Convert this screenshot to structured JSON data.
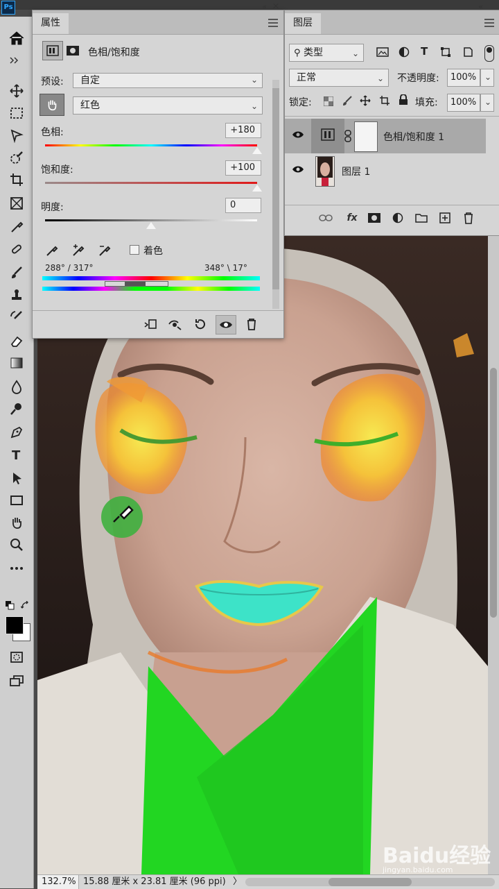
{
  "app": {
    "logo": "Ps"
  },
  "properties_panel": {
    "tab": "属性",
    "title": "色相/饱和度",
    "preset_label": "预设:",
    "preset_value": "自定",
    "channel_value": "红色",
    "hue_label": "色相:",
    "hue_value": "+180",
    "hue_level": 1.0,
    "saturation_label": "饱和度:",
    "saturation_value": "+100",
    "saturation_level": 1.0,
    "lightness_label": "明度:",
    "lightness_value": "0",
    "lightness_level": 0.5,
    "colorize_label": "着色",
    "colorize_checked": false,
    "range_left": "288° / 317°",
    "range_right": "348° \\ 17°"
  },
  "layers_panel": {
    "tab": "图层",
    "filter_value": "类型",
    "blend_mode": "正常",
    "opacity_label": "不透明度:",
    "opacity_value": "100%",
    "lock_label": "锁定:",
    "fill_label": "填充:",
    "fill_value": "100%",
    "layers": [
      {
        "name": "色相/饱和度 1",
        "type": "adjustment",
        "selected": true
      },
      {
        "name": "图层 1",
        "type": "image",
        "selected": false
      }
    ],
    "footer_icons": [
      "link-icon",
      "fx-icon",
      "mask-icon",
      "adjustment-icon",
      "folder-icon",
      "new-layer-icon",
      "trash-icon"
    ]
  },
  "status": {
    "zoom": "132.7%",
    "doc_info": "15.88 厘米 x 23.81 厘米 (96 ppi)",
    "arrow": "〉"
  },
  "watermark": {
    "brand": "Baidu经验",
    "url": "jingyan.baidu.com"
  },
  "colors": {
    "panel_bg": "#d5d5d5",
    "app_bg": "#4a4a4a",
    "highlight_green": "#22d622",
    "lip_cyan": "#3de3c8"
  }
}
